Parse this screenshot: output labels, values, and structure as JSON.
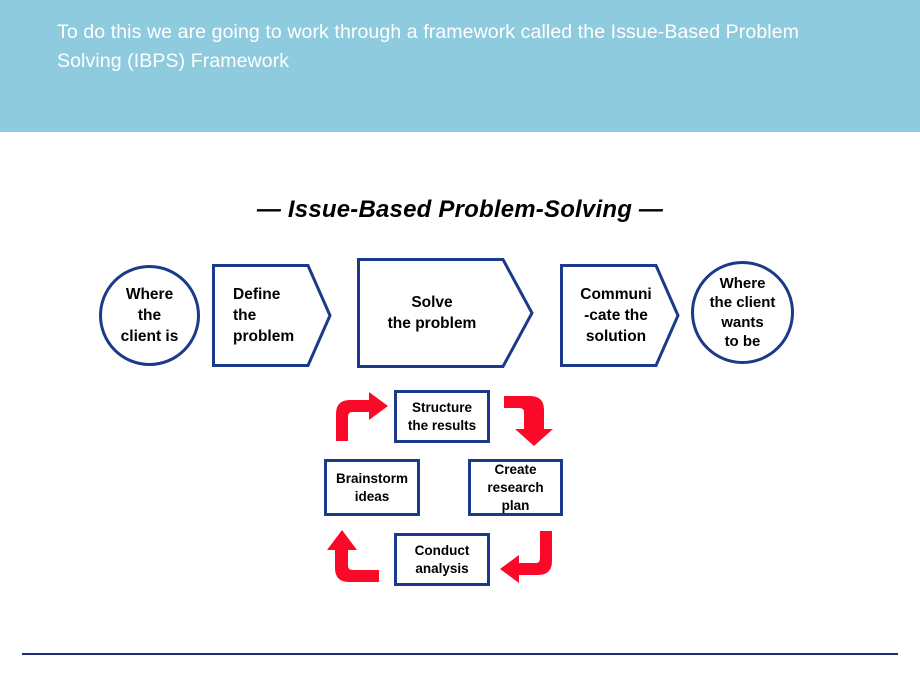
{
  "header": {
    "text": "To do this we are going to work through a framework called the Issue-Based Problem\nSolving (IBPS) Framework",
    "background_color": "#8ECBDF",
    "text_color": "#FFFFFF"
  },
  "diagram": {
    "title": "— Issue-Based Problem-Solving —",
    "outline_color": "#1B3A87",
    "arrow_color": "#FA0A28",
    "flow_steps": [
      {
        "id": "where-client-is",
        "shape": "circle",
        "label": "Where\nthe\nclient is"
      },
      {
        "id": "define-the-problem",
        "shape": "chevron",
        "label": "Define\nthe\nproblem"
      },
      {
        "id": "solve-the-problem",
        "shape": "chevron",
        "label": "Solve\nthe problem"
      },
      {
        "id": "communicate-the-solution",
        "shape": "chevron",
        "label": "Communi\n-cate the\nsolution"
      },
      {
        "id": "where-client-wants-to-be",
        "shape": "circle",
        "label": "Where\nthe client\nwants\nto be"
      }
    ],
    "cycle_steps": [
      {
        "id": "structure-the-results",
        "position": "top",
        "label": "Structure\nthe results"
      },
      {
        "id": "create-research-plan",
        "position": "right",
        "label": "Create\nresearch\nplan"
      },
      {
        "id": "conduct-analysis",
        "position": "bottom",
        "label": "Conduct\nanalysis"
      },
      {
        "id": "brainstorm-ideas",
        "position": "left",
        "label": "Brainstorm\nideas"
      }
    ],
    "cycle_arrows": [
      {
        "id": "arrow-brainstorm-to-structure",
        "direction": "up-right"
      },
      {
        "id": "arrow-structure-to-create",
        "direction": "right-down"
      },
      {
        "id": "arrow-create-to-conduct",
        "direction": "down-left"
      },
      {
        "id": "arrow-conduct-to-brainstorm",
        "direction": "left-up"
      }
    ]
  },
  "footer": {
    "rule_color": "#1F2E7A"
  }
}
